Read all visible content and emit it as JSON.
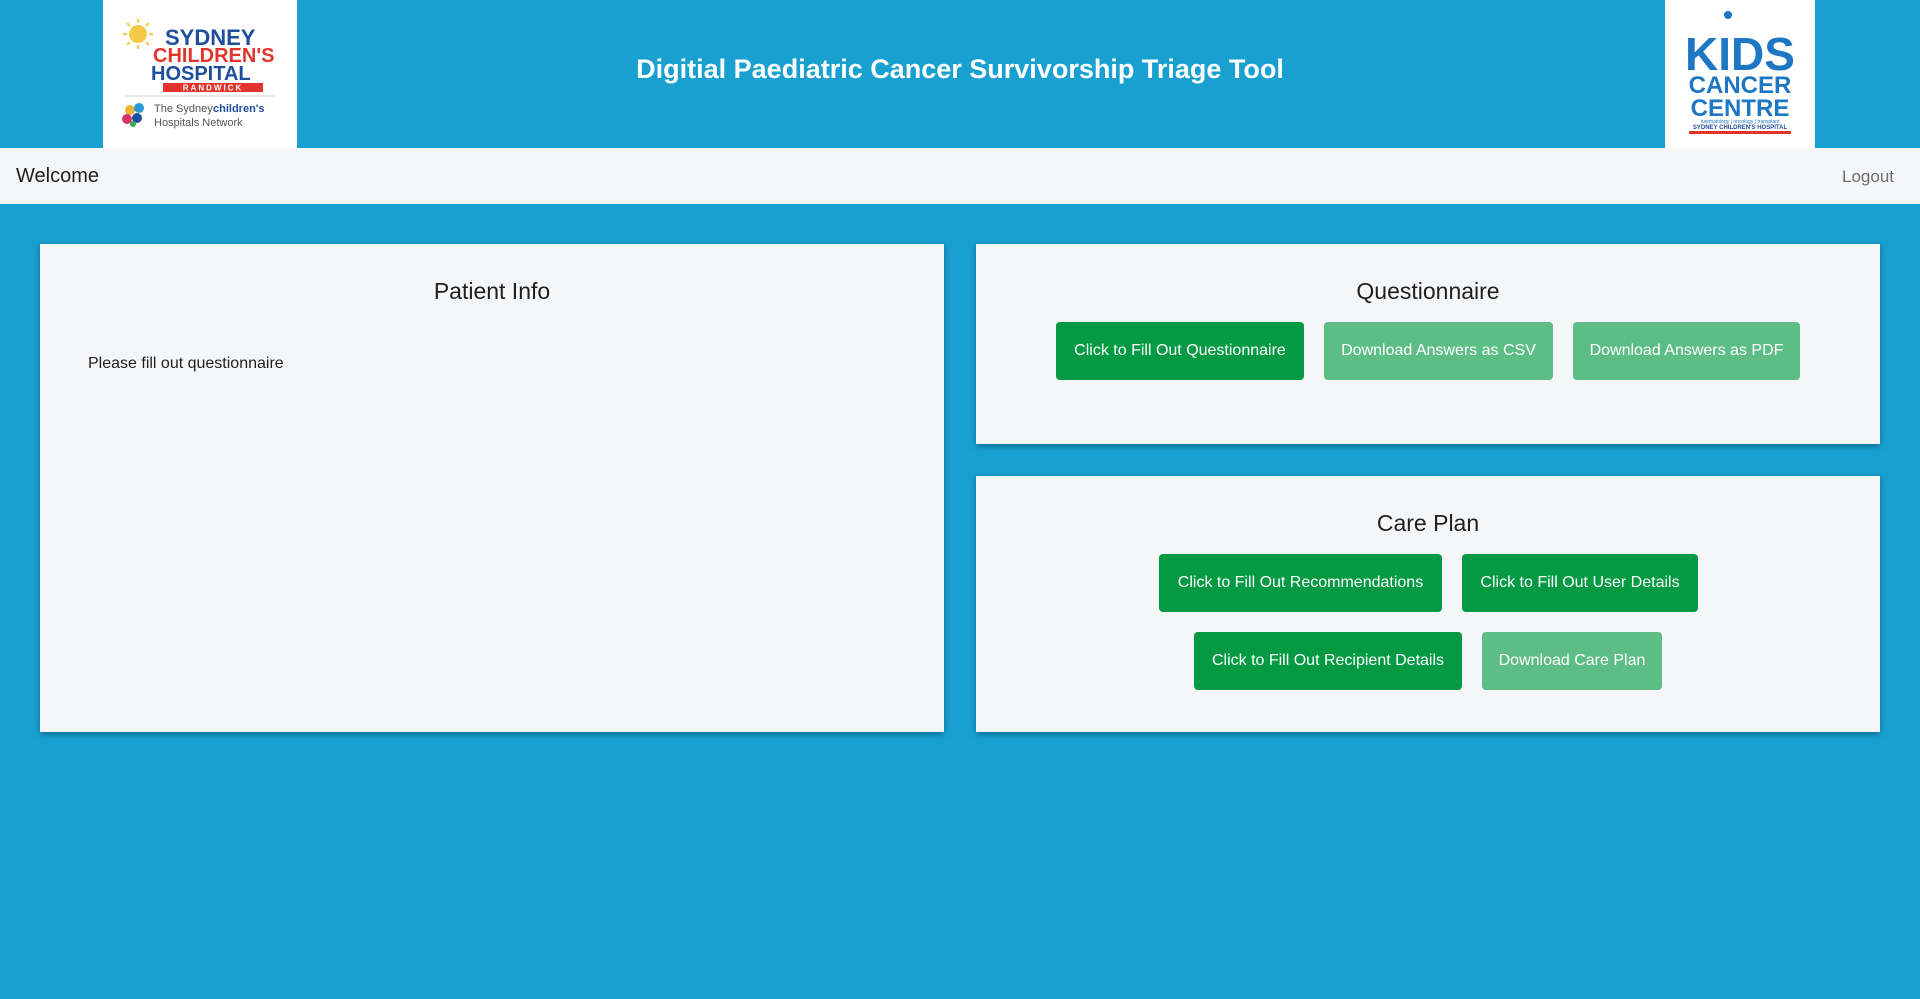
{
  "header": {
    "title": "Digitial Paediatric Cancer Survivorship Triage Tool",
    "logo_left": {
      "line1": "SYDNEY",
      "line2": "CHILDREN'S",
      "line3": "HOSPITAL",
      "line4": "RANDWICK",
      "network_line1_a": "The Sydney",
      "network_line1_b": "children's",
      "network_line2": "Hospitals Network"
    },
    "logo_right": {
      "line1": "KIDS",
      "line2": "CANCER",
      "line3": "CENTRE",
      "tagline": "haematology | oncology | transplant",
      "footer": "SYDNEY CHILDREN'S HOSPITAL"
    }
  },
  "navbar": {
    "brand": "Welcome",
    "logout": "Logout"
  },
  "patient_info": {
    "title": "Patient Info",
    "message": "Please fill out questionnaire"
  },
  "questionnaire": {
    "title": "Questionnaire",
    "fill_button": "Click to Fill Out Questionnaire",
    "csv_button": "Download Answers as CSV",
    "pdf_button": "Download Answers as PDF"
  },
  "care_plan": {
    "title": "Care Plan",
    "recommendations_button": "Click to Fill Out Recommendations",
    "user_details_button": "Click to Fill Out User Details",
    "recipient_details_button": "Click to Fill Out Recipient Details",
    "download_button": "Download Care Plan"
  },
  "colors": {
    "background": "#18a0d1",
    "panel": "#f5f6f8",
    "button_primary": "#049a43",
    "button_disabled": "#5cbd85"
  }
}
